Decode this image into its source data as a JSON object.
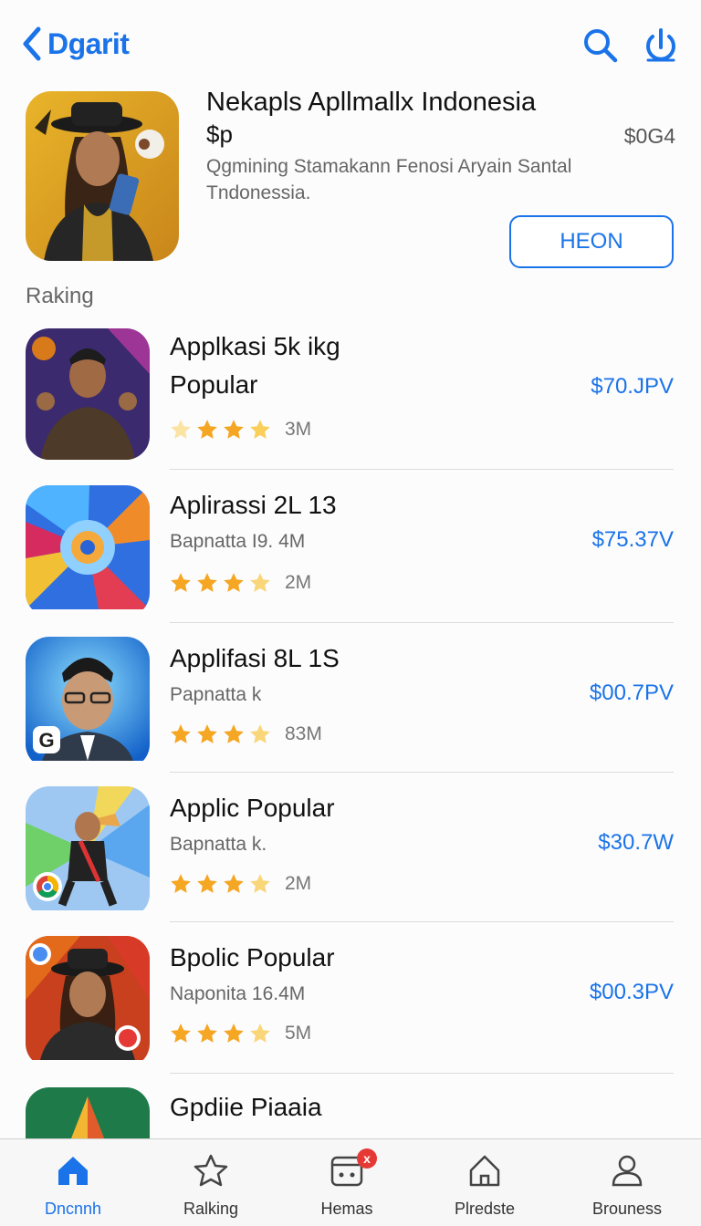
{
  "header": {
    "back_label": "Dgarit",
    "search_icon": "search-icon",
    "power_icon": "power-icon"
  },
  "featured": {
    "title": "Nekapls Apllmallx Indonesia",
    "subtitle": "$p",
    "price": "$0G4",
    "description": "Qgmining Stamakann Fenosi Aryain Santal Tndonessia.",
    "button_label": "HEON"
  },
  "section_title": "Raking",
  "apps": [
    {
      "name": "Applkasi 5k ikg",
      "meta": "Popular",
      "stars": 4,
      "count": "3M",
      "price": "$70.JPV"
    },
    {
      "name": "Aplirassi 2L 13",
      "meta": "Bapnatta I9. 4M",
      "stars": 4,
      "count": "2M",
      "price": "$75.37V"
    },
    {
      "name": "Applifasi 8L 1S",
      "meta": "Papnatta k",
      "stars": 4,
      "count": "83M",
      "price": "$00.7PV"
    },
    {
      "name": "Applic Popular",
      "meta": "Bapnatta k.",
      "stars": 4,
      "count": "2M",
      "price": "$30.7W"
    },
    {
      "name": "Bpolic Popular",
      "meta": "Naponita 16.4M",
      "stars": 4,
      "count": "5M",
      "price": "$00.3PV"
    },
    {
      "name": "Gpdiie Piaaia",
      "meta": "",
      "stars": 0,
      "count": "",
      "price": ""
    }
  ],
  "tabs": [
    {
      "label": "Dncnnh",
      "icon": "home-icon",
      "active": true
    },
    {
      "label": "Ralking",
      "icon": "star-house-icon",
      "active": false
    },
    {
      "label": "Hemas",
      "icon": "games-icon",
      "active": false,
      "badge": "x"
    },
    {
      "label": "Plredste",
      "icon": "house-outline-icon",
      "active": false
    },
    {
      "label": "Brouness",
      "icon": "profile-icon",
      "active": false
    }
  ],
  "colors": {
    "accent": "#1a73e8",
    "star": "#f5a623",
    "badge": "#e53935"
  }
}
